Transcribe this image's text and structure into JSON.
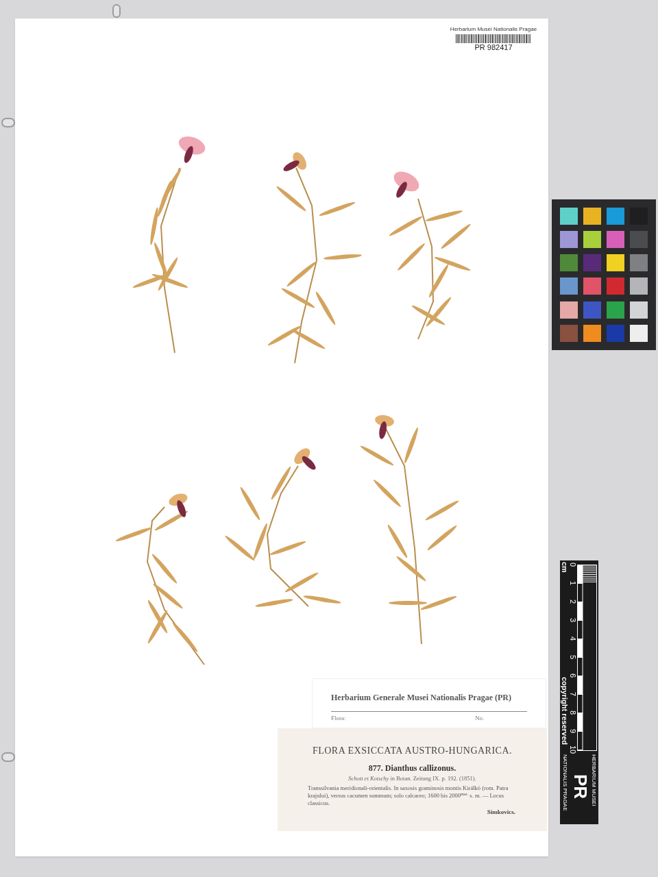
{
  "barcode_label": {
    "institution": "Herbarium Musei Nationalis Pragae",
    "number": "PR 982417"
  },
  "color_chart": {
    "swatches": [
      {
        "color": "#5fd0c8"
      },
      {
        "color": "#e8b322"
      },
      {
        "color": "#1a9ad6"
      },
      {
        "color": "#1f1f22"
      },
      {
        "color": "#9d97d6"
      },
      {
        "color": "#a8cf3c"
      },
      {
        "color": "#d660b8"
      },
      {
        "color": "#4a4c50"
      },
      {
        "color": "#4e8a3a"
      },
      {
        "color": "#5a2a7a"
      },
      {
        "color": "#f0d020"
      },
      {
        "color": "#7e8084"
      },
      {
        "color": "#6a96cc"
      },
      {
        "color": "#e0546a"
      },
      {
        "color": "#d02a30"
      },
      {
        "color": "#b3b5b8"
      },
      {
        "color": "#e5a8a6"
      },
      {
        "color": "#3e56c4"
      },
      {
        "color": "#2aa44a"
      },
      {
        "color": "#d2d4d6"
      },
      {
        "color": "#8a5040"
      },
      {
        "color": "#ee8c20"
      },
      {
        "color": "#1a3aa8"
      },
      {
        "color": "#eeeeee"
      }
    ]
  },
  "scale_bar": {
    "unit": "cm",
    "ticks": [
      "0",
      "1",
      "2",
      "3",
      "4",
      "5",
      "6",
      "7",
      "8",
      "9",
      "10"
    ],
    "notice": "copyright reserved",
    "logo": "PR",
    "logo_top": "HERBARIUM MUSEI",
    "logo_bottom": "NATIONALIS PRAGAE"
  },
  "herbarium_label": {
    "title": "Herbarium Generale Musei Nationalis Pragae (PR)",
    "fields": [
      "Flora:",
      "No."
    ]
  },
  "exsiccata_label": {
    "series": "FLORA EXSICCATA AUSTRO-HUNGARICA.",
    "taxon": "877. Dianthus callizonus.",
    "citation": "*Schott et Kotschy* in Botan. Zeitung IX. p. 192. (1851).",
    "locality": "Transsilvania meridionali-orientalis. In saxosis graminosis montis Királkö (rom. Patra krajului), versus cacumen summum; solo calcareo; 1600 bis 2000$^{met.}$ s. m. — Locus classicus.",
    "collector": "Simkovics."
  }
}
